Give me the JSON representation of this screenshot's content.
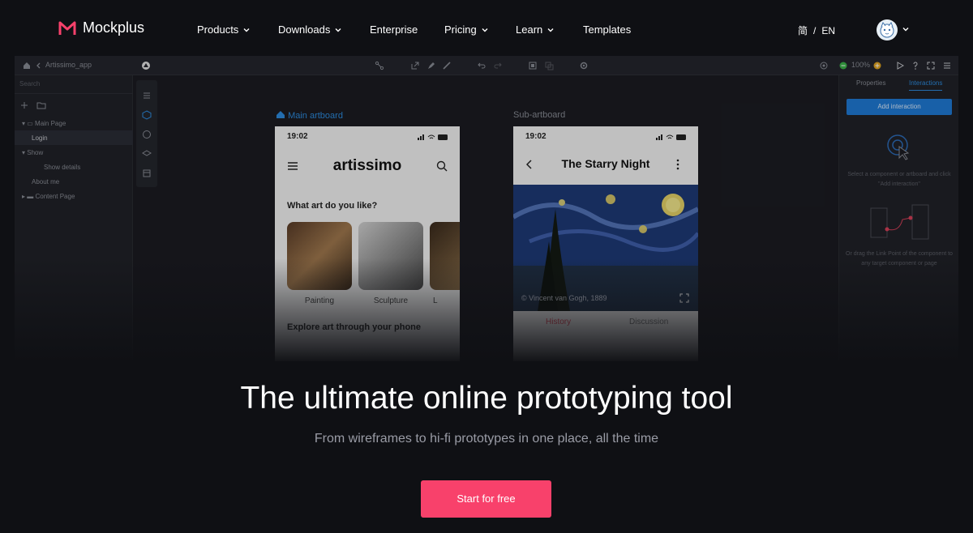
{
  "nav": {
    "logo": "Mockplus",
    "items": [
      {
        "label": "Products",
        "dropdown": true
      },
      {
        "label": "Downloads",
        "dropdown": true
      },
      {
        "label": "Enterprise",
        "dropdown": false
      },
      {
        "label": "Pricing",
        "dropdown": true
      },
      {
        "label": "Learn",
        "dropdown": true
      },
      {
        "label": "Templates",
        "dropdown": false
      }
    ],
    "lang_cn": "简",
    "lang_sep": "/",
    "lang_en": "EN"
  },
  "editor": {
    "project": "Artissimo_app",
    "zoom": "100%",
    "search_placeholder": "Search",
    "tree": [
      "Main Page",
      "Login",
      "Show",
      "Show details",
      "About me",
      "Content Page"
    ],
    "right_tabs": [
      "Properties",
      "Interactions"
    ],
    "add_interaction": "Add interaction",
    "hint1": "Select a component or artboard and click \"Add interaction\"",
    "hint2": "Or drag the Link Point of the component to any target component or page",
    "main_artboard_label": "Main artboard",
    "sub_artboard_label": "Sub-artboard",
    "main_phone": {
      "time": "19:02",
      "title": "artissimo",
      "question": "What art do you like?",
      "categories": [
        "Painting",
        "Sculpture",
        "L"
      ],
      "explore": "Explore art through your phone"
    },
    "sub_phone": {
      "time": "19:02",
      "title": "The Starry Night",
      "credit": "© Vincent van Gogh, 1889",
      "tabs": [
        "History",
        "Discussion"
      ]
    }
  },
  "hero": {
    "title": "The ultimate online prototyping tool",
    "subtitle": "From wireframes to hi-fi prototypes in one place, all the time",
    "cta": "Start for free"
  },
  "colors": {
    "accent": "#f8416b",
    "blue": "#1f7cd8"
  }
}
